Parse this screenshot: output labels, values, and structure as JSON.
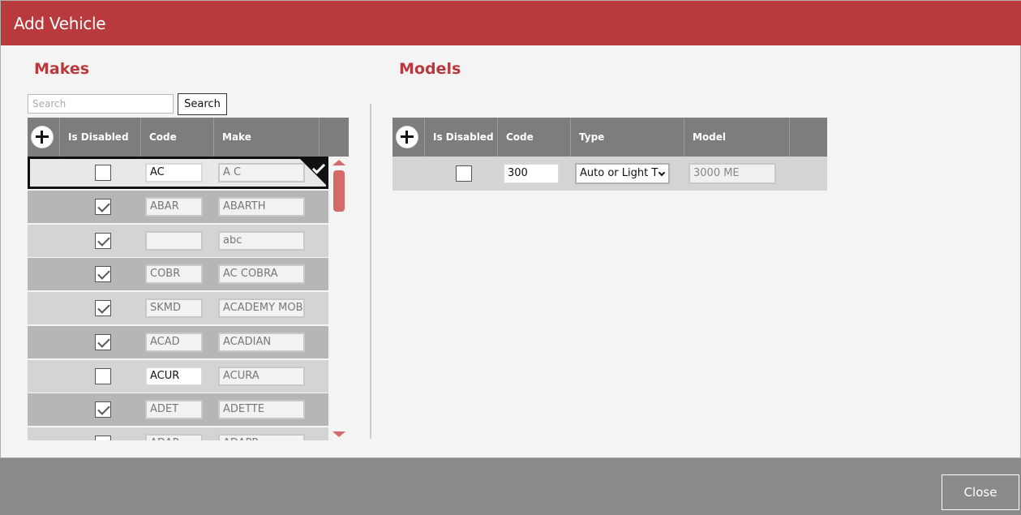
{
  "dialog": {
    "title": "Add Vehicle"
  },
  "makes": {
    "title": "Makes",
    "search_placeholder": "Search",
    "search_label": "Search",
    "columns": [
      "Is Disabled",
      "Code",
      "Make"
    ],
    "rows": [
      {
        "disabled": false,
        "code": "AC",
        "make": "A C",
        "selected": true
      },
      {
        "disabled": true,
        "code": "ABAR",
        "make": "ABARTH"
      },
      {
        "disabled": true,
        "code": "",
        "make": "abc"
      },
      {
        "disabled": true,
        "code": "COBR",
        "make": "AC COBRA"
      },
      {
        "disabled": true,
        "code": "SKMD",
        "make": "ACADEMY MOBI"
      },
      {
        "disabled": true,
        "code": "ACAD",
        "make": "ACADIAN"
      },
      {
        "disabled": false,
        "code": "ACUR",
        "make": "ACURA"
      },
      {
        "disabled": true,
        "code": "ADET",
        "make": "ADETTE"
      },
      {
        "disabled": true,
        "code": "ADAP",
        "make": "ADAPP"
      }
    ]
  },
  "models": {
    "title": "Models",
    "columns": [
      "Is Disabled",
      "Code",
      "Type",
      "Model"
    ],
    "rows": [
      {
        "disabled": false,
        "code": "300",
        "type": "Auto or Light T",
        "model": "3000 ME"
      }
    ]
  },
  "footer": {
    "close_label": "Close"
  },
  "colors": {
    "accent": "#b83a3c",
    "header_gray": "#7d7d7d",
    "scroll": "#d46a6a"
  },
  "icons": {
    "add": "plus-circle-icon",
    "selected": "checkmark-icon"
  }
}
